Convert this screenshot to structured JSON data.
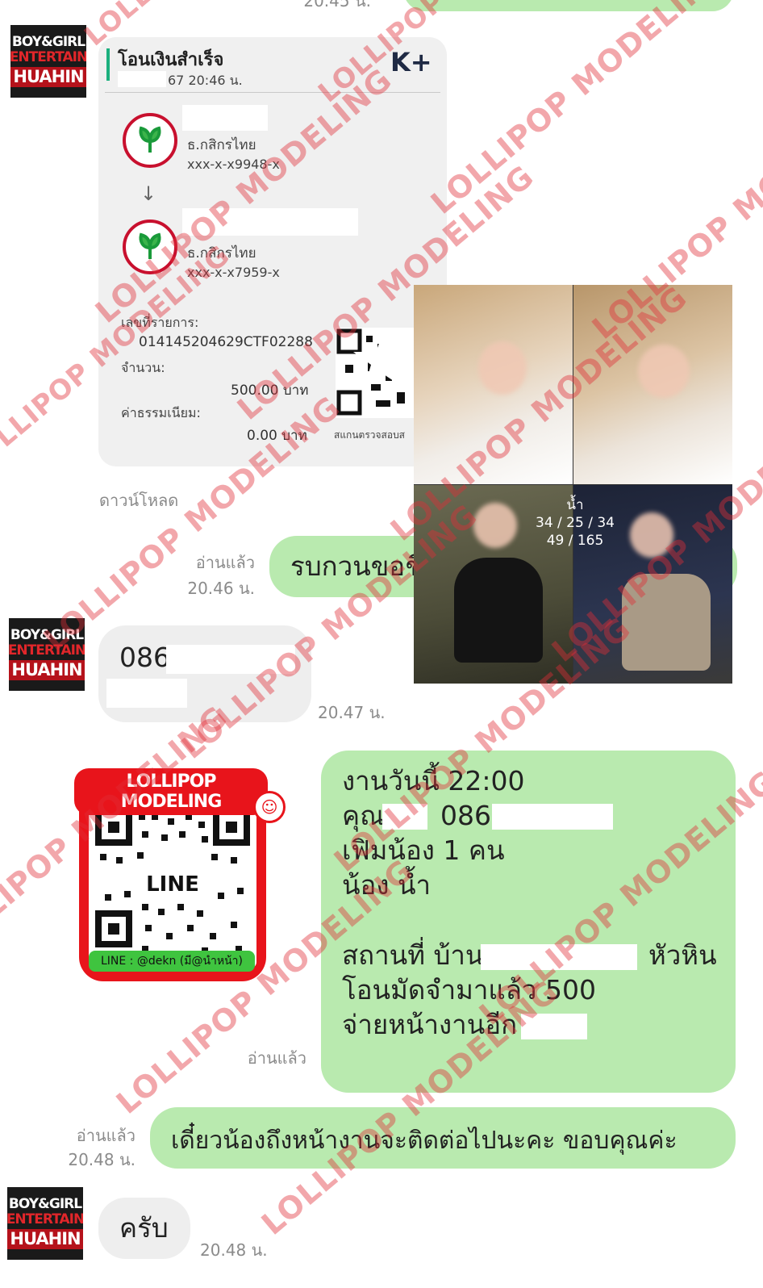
{
  "top_partial_time": "20.45 น.",
  "avatar": {
    "line1": "BOY&GIRL",
    "line2": "ENTERTAIN",
    "line3": "HUAHIN"
  },
  "slip": {
    "title": "โอนเงินสำเร็จ",
    "datetime": "67  20:46 น.",
    "brand": "K+",
    "from_bank": "ธ.กสิกรไทย",
    "from_account": "xxx-x-x9948-x",
    "to_bank": "ธ.กสิกรไทย",
    "to_account": "xxx-x-x7959-x",
    "ref_label": "เลขที่รายการ:",
    "ref_value": "014145204629CTF02288",
    "amount_label": "จำนวน:",
    "amount_value": "500.00 บาท",
    "fee_label": "ค่าธรรมเนียม:",
    "fee_value": "0.00 บาท",
    "scan_label": "สแกนตรวจสอบส"
  },
  "download_label": "ดาวน์โหลด",
  "msg1": {
    "read": "อ่านแล้ว",
    "time": "20.46 น.",
    "text": "รบกวนขอชื่"
  },
  "photo_caption": {
    "name": "น้ำ",
    "line1": "34 / 25 / 34",
    "line2": "49 / 165"
  },
  "msg2": {
    "text": "086-",
    "time": "20.47 น."
  },
  "qr": {
    "title": "LOLLIPOP MODELING",
    "center": "LINE",
    "footer": "LINE :  @dekn (มี@นำหน้า)"
  },
  "msg3": {
    "read": "อ่านแล้ว",
    "lines": [
      "งานวันนี้ 22:00",
      "คุณ",
      "086-",
      "เฟิมน้อง 1 คน",
      "น้อง น้ำ",
      "สถานที่ บ้าน",
      "หัวหิน",
      "โอนมัดจำมาแล้ว 500",
      "จ่ายหน้างานอีก"
    ]
  },
  "msg4": {
    "read": "อ่านแล้ว",
    "time": "20.48 น.",
    "text": "เดี๋ยวน้องถึงหน้างานจะติดต่อไปนะคะ ขอบคุณค่ะ"
  },
  "msg5": {
    "text": "ครับ",
    "time": "20.48 น."
  },
  "watermark": "LOLLIPOP MODELING"
}
